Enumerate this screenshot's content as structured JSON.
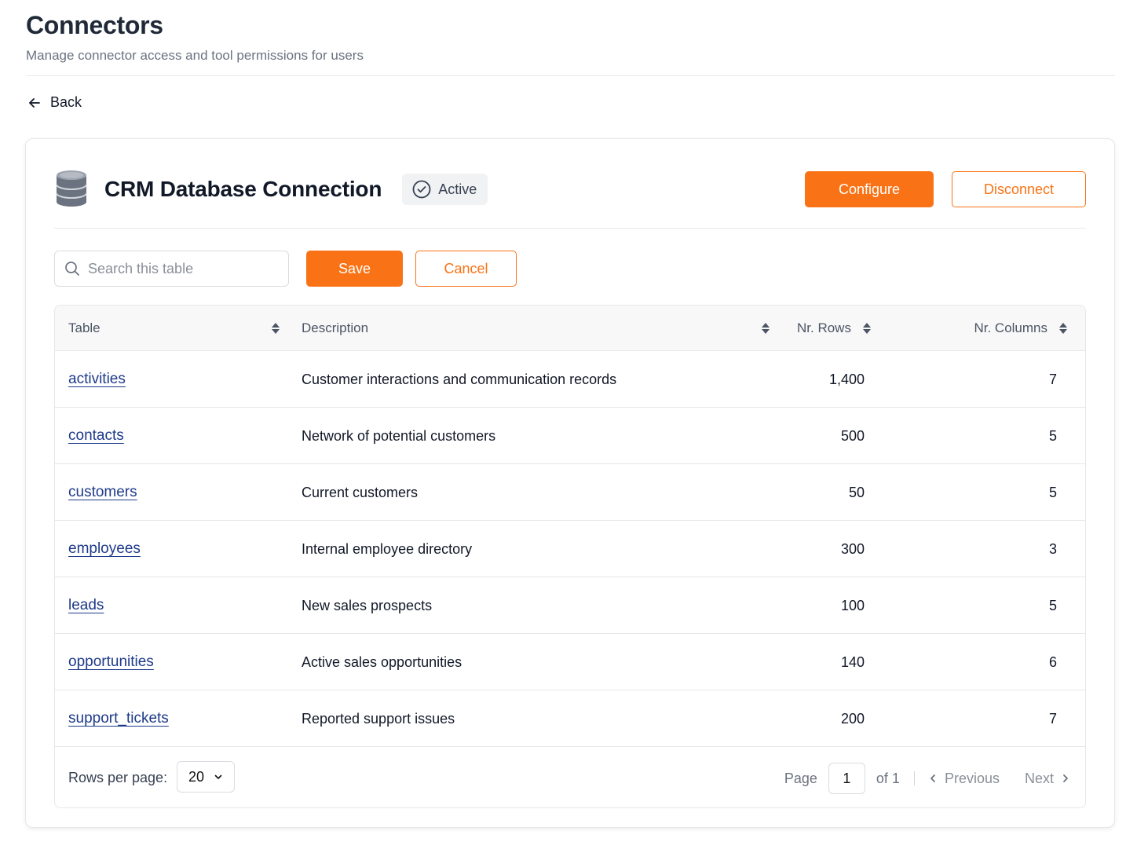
{
  "header": {
    "title": "Connectors",
    "subtitle": "Manage connector access and tool permissions for users"
  },
  "back": {
    "label": "Back"
  },
  "connection": {
    "icon": "database-icon",
    "title": "CRM Database Connection",
    "status": "Active",
    "status_icon": "check-circle-icon",
    "configure_label": "Configure",
    "disconnect_label": "Disconnect"
  },
  "toolbar": {
    "search_placeholder": "Search this table",
    "save_label": "Save",
    "cancel_label": "Cancel"
  },
  "table": {
    "columns": {
      "table": "Table",
      "description": "Description",
      "rows": "Nr. Rows",
      "columns": "Nr. Columns"
    },
    "rows": [
      {
        "name": "activities",
        "description": "Customer interactions and communication records",
        "rows": "1,400",
        "columns": "7"
      },
      {
        "name": "contacts",
        "description": "Network of potential customers",
        "rows": "500",
        "columns": "5"
      },
      {
        "name": "customers",
        "description": "Current customers",
        "rows": "50",
        "columns": "5"
      },
      {
        "name": "employees",
        "description": "Internal employee directory",
        "rows": "300",
        "columns": "3"
      },
      {
        "name": "leads",
        "description": "New sales prospects",
        "rows": "100",
        "columns": "5"
      },
      {
        "name": "opportunities",
        "description": "Active sales opportunities",
        "rows": "140",
        "columns": "6"
      },
      {
        "name": "support_tickets",
        "description": "Reported support issues",
        "rows": "200",
        "columns": "7"
      }
    ]
  },
  "footer": {
    "rows_per_page_label": "Rows per page:",
    "rows_per_page_value": "20",
    "page_label": "Page",
    "page_value": "1",
    "of_label": "of 1",
    "previous_label": "Previous",
    "next_label": "Next"
  },
  "colors": {
    "accent": "#f97316",
    "link": "#1e3a8a"
  }
}
